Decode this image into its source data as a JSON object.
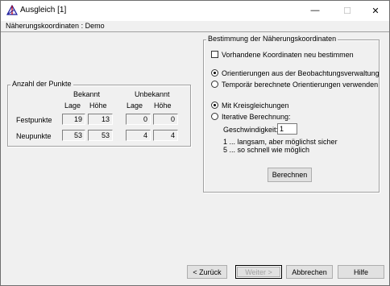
{
  "window": {
    "title": "Ausgleich [1]",
    "controls": {
      "minimize": "—",
      "maximize": "☐",
      "close": "✕"
    }
  },
  "header": {
    "text": "Näherungskoordinaten : Demo"
  },
  "points_group": {
    "title": "Anzahl der Punkte",
    "known": "Bekannt",
    "unknown": "Unbekannt",
    "lage": "Lage",
    "hoehe": "Höhe",
    "rows": [
      {
        "label": "Festpunkte",
        "known_lage": "19",
        "known_hoehe": "13",
        "unknown_lage": "0",
        "unknown_hoehe": "0"
      },
      {
        "label": "Neupunkte",
        "known_lage": "53",
        "known_hoehe": "53",
        "unknown_lage": "4",
        "unknown_hoehe": "4"
      }
    ]
  },
  "settings_group": {
    "title": "Bestimmung der Näherungskoordinaten",
    "checkbox_label": "Vorhandene Koordinaten neu bestimmen",
    "radio_orientation_observed": "Orientierungen aus der Beobachtungsverwaltung",
    "radio_orientation_temp": "Temporär berechnete Orientierungen verwenden",
    "radio_circle": "Mit Kreisgleichungen",
    "radio_iterative": "Iterative Berechnung:",
    "speed_label": "Geschwindigkeit:",
    "speed_value": "1",
    "hint_1": "1 ... langsam, aber möglichst sicher",
    "hint_5": "5 ... so schnell wie möglich",
    "compute_button": "Berechnen"
  },
  "footer": {
    "back": "< Zurück",
    "next": "Weiter >",
    "cancel": "Abbrechen",
    "help": "Hilfe"
  }
}
